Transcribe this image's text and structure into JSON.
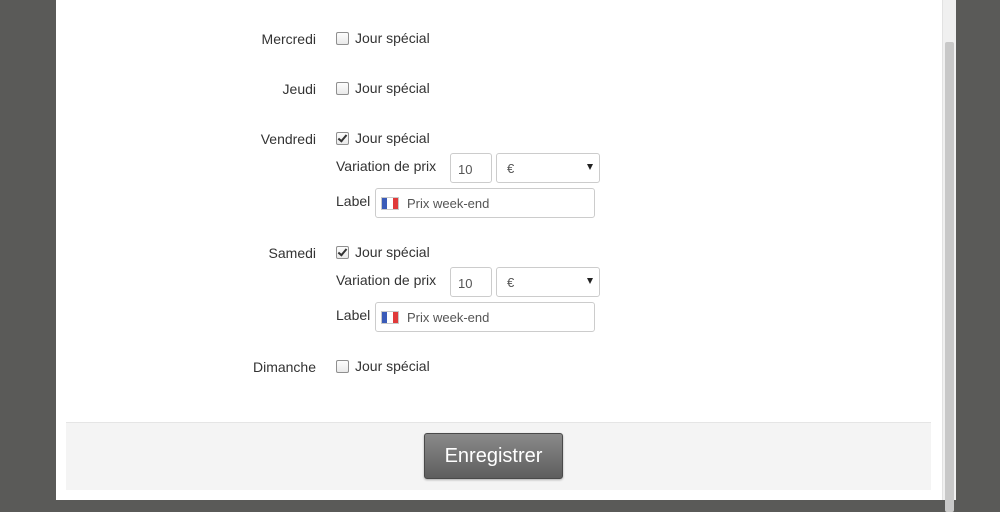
{
  "days": [
    {
      "name": "Mercredi",
      "special_label": "Jour spécial",
      "checked": false
    },
    {
      "name": "Jeudi",
      "special_label": "Jour spécial",
      "checked": false
    },
    {
      "name": "Vendredi",
      "special_label": "Jour spécial",
      "checked": true,
      "variation_label": "Variation de prix",
      "variation_value": "10",
      "currency": "€",
      "label_label": "Label",
      "label_value": "Prix week-end"
    },
    {
      "name": "Samedi",
      "special_label": "Jour spécial",
      "checked": true,
      "variation_label": "Variation de prix",
      "variation_value": "10",
      "currency": "€",
      "label_label": "Label",
      "label_value": "Prix week-end"
    },
    {
      "name": "Dimanche",
      "special_label": "Jour spécial",
      "checked": false
    }
  ],
  "footer": {
    "save_label": "Enregistrer"
  },
  "colors": {
    "backdrop": "#5a5a58",
    "button": "#6e6e6e",
    "flag_blue": "#3a5bb8",
    "flag_white": "#ffffff",
    "flag_red": "#e03a3a"
  },
  "icons": {
    "flag": "flag-france-icon",
    "dropdown": "chevron-down-icon",
    "checkbox": "checkbox"
  }
}
